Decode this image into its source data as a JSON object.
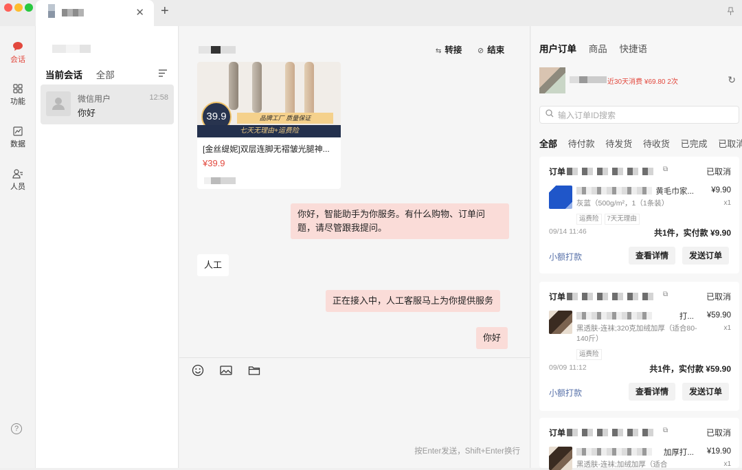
{
  "rail": {
    "items": [
      {
        "label": "会话"
      },
      {
        "label": "功能"
      },
      {
        "label": "数据"
      },
      {
        "label": "人员"
      }
    ],
    "help": "?"
  },
  "tabbar": {
    "close": "✕",
    "new_tab": "+"
  },
  "conversations": {
    "tabs": [
      "当前会话",
      "全部"
    ],
    "items": [
      {
        "name": "微信用户",
        "time": "12:58",
        "last_message": "你好"
      }
    ]
  },
  "chat": {
    "actions": {
      "transfer": "转接",
      "end": "结束"
    },
    "product_card": {
      "price_badge": "39.9",
      "banner_top": "品牌工厂 质量保证",
      "banner_bottom": "七天无理由+运费险",
      "title": "[金丝缇妮]双层连脚无褶皱光腿神...",
      "price": "¥39.9"
    },
    "messages": [
      {
        "from": "agent",
        "text": "你好，智能助手为你服务。有什么购物、订单问题，请尽管跟我提问。"
      },
      {
        "from": "user",
        "text": "人工"
      },
      {
        "from": "agent",
        "text": "正在接入中，人工客服马上为你提供服务"
      },
      {
        "from": "agent",
        "text": "你好"
      }
    ],
    "input_hint": "按Enter发送，Shift+Enter换行"
  },
  "right_panel": {
    "tabs": [
      "用户订单",
      "商品",
      "快捷语"
    ],
    "user_stat": "近30天消费 ¥69.80 2次",
    "search_placeholder": "输入订单ID搜索",
    "filters": [
      "全部",
      "待付款",
      "待发货",
      "待收货",
      "已完成",
      "已取消"
    ],
    "orders": [
      {
        "id_label": "订单",
        "status": "已取消",
        "name_tail": "黄毛巾家...",
        "spec": "灰蓝（500g/m²，1（1条装）",
        "price": "¥9.90",
        "qty": "x1",
        "tags": [
          "运费险",
          "7天无理由"
        ],
        "time": "09/14 11:46",
        "total": "共1件，实付款 ¥9.90",
        "small_pay": "小额打款",
        "detail_btn": "查看详情",
        "send_btn": "发送订单"
      },
      {
        "id_label": "订单",
        "status": "已取消",
        "name_tail": "打...",
        "spec": "黑透肤-连袜;320克加绒加厚（适合80-140斤）",
        "price": "¥59.90",
        "qty": "x1",
        "tags": [
          "运费险"
        ],
        "time": "09/09 11:12",
        "total": "共1件，实付款 ¥59.90",
        "small_pay": "小额打款",
        "detail_btn": "查看详情",
        "send_btn": "发送订单"
      },
      {
        "id_label": "订单",
        "status": "已取消",
        "name_tail": "加厚打...",
        "spec": "黑透肤-连袜;加绒加厚（适合",
        "price": "¥19.90",
        "qty": "x1"
      }
    ]
  },
  "colors": {
    "accent": "#e2483d",
    "bubble_me": "#fadcd8",
    "link": "#556fa8"
  }
}
